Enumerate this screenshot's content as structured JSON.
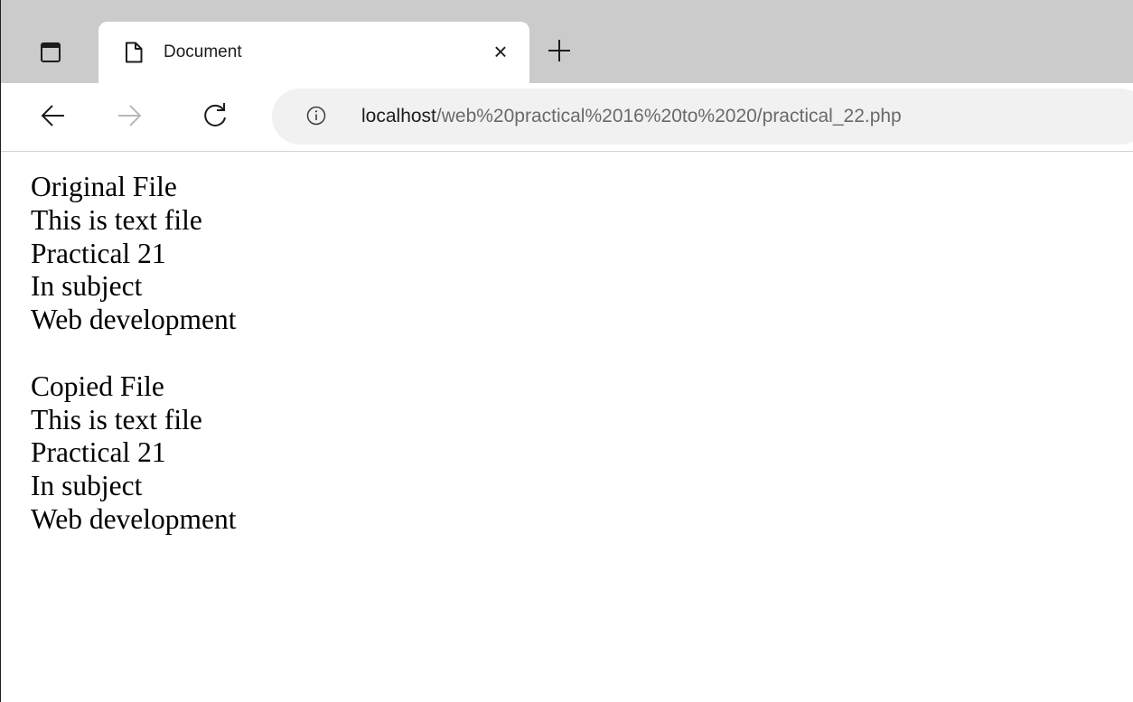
{
  "tab": {
    "title": "Document",
    "close_glyph": "×"
  },
  "toolbar": {
    "url_host": "localhost",
    "url_path": "/web%20practical%2016%20to%2020/practical_22.php"
  },
  "icons": {
    "tab_actions": "tab-actions-icon",
    "page": "page-icon",
    "new_tab": "plus-icon",
    "back": "arrow-left-icon",
    "forward": "arrow-right-icon",
    "reload": "reload-icon",
    "info": "info-icon"
  },
  "content": {
    "original_heading": "Original File",
    "original_lines": [
      "This is text file",
      "Practical 21",
      "In subject",
      "Web development"
    ],
    "copied_heading": "Copied File",
    "copied_lines": [
      "This is text file",
      "Practical 21",
      "In subject",
      "Web development"
    ]
  }
}
